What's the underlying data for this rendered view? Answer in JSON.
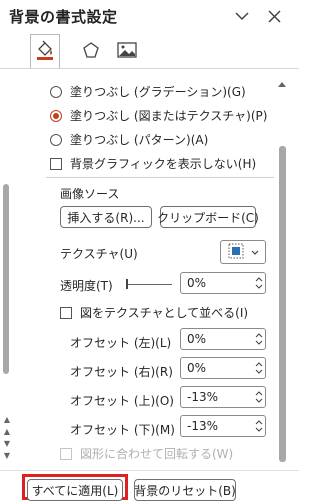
{
  "header": {
    "title": "背景の書式設定"
  },
  "tabs": [
    {
      "name": "fill",
      "icon": "paint-bucket-icon"
    },
    {
      "name": "effects",
      "icon": "pentagon-icon"
    },
    {
      "name": "picture",
      "icon": "picture-icon"
    }
  ],
  "fill": {
    "gradient_label": "塗りつぶし (グラデーション)(G)",
    "picture_label": "塗りつぶし (図またはテクスチャ)(P)",
    "pattern_label": "塗りつぶし (パターン)(A)",
    "hide_graphics_label": "背景グラフィックを表示しない(H)",
    "selected": "picture"
  },
  "picture_source": {
    "heading": "画像ソース",
    "insert_label": "挿入する(R)...",
    "clipboard_label": "クリップボード(C)"
  },
  "texture": {
    "label": "テクスチャ(U)"
  },
  "transparency": {
    "label": "透明度(T)",
    "value": "0%",
    "slider_fraction": 0.0
  },
  "tile": {
    "label": "図をテクスチャとして並べる(I)",
    "checked": false
  },
  "offsets": [
    {
      "label": "オフセット (左)(L)",
      "value": "0%"
    },
    {
      "label": "オフセット (右)(R)",
      "value": "0%"
    },
    {
      "label": "オフセット (上)(O)",
      "value": "-13%"
    },
    {
      "label": "オフセット (下)(M)",
      "value": "-13%"
    }
  ],
  "rotate": {
    "label": "図形に合わせて回転する(W)",
    "disabled": true
  },
  "footer": {
    "apply_all_label": "すべてに適用(L)",
    "reset_label": "背景のリセット(B)"
  },
  "colors": {
    "accent": "#c43e1c",
    "highlight_border": "#e02020"
  }
}
